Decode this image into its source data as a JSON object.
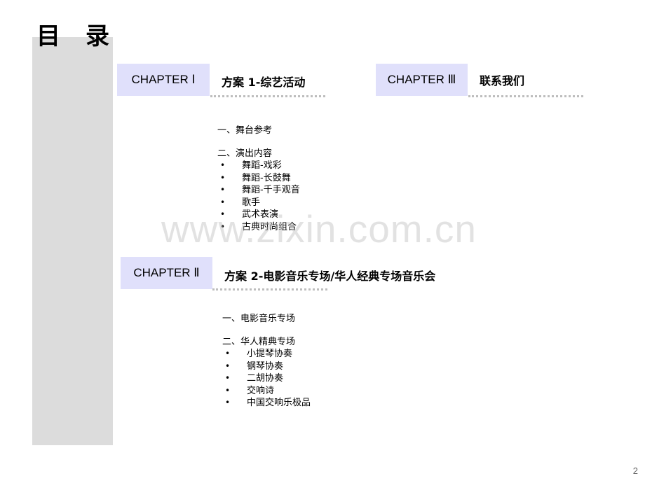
{
  "page": {
    "title_chars": [
      "目",
      "录"
    ],
    "page_number": "2",
    "watermark": "www.zixin.com.cn"
  },
  "colors": {
    "sidebar": "#dcdcdc",
    "chapter_box": "#e0e0fb",
    "dotted_line": "#bdbdbd"
  },
  "chapters": [
    {
      "label": "CHAPTER Ⅰ",
      "title": "方案 1-综艺活动",
      "items": {
        "sections": [
          {
            "heading": "一、舞台参考",
            "bullets": []
          },
          {
            "heading": "二、演出内容",
            "bullets": [
              "舞蹈-戏彩",
              "舞蹈-长鼓舞",
              "舞蹈-千手观音",
              "歌手",
              "武术表演",
              "古典时尚组合"
            ]
          }
        ]
      }
    },
    {
      "label": "CHAPTER Ⅱ",
      "title": "方案 2-电影音乐专场/华人经典专场音乐会",
      "items": {
        "sections": [
          {
            "heading": "一、电影音乐专场",
            "bullets": []
          },
          {
            "heading": "二、华人精典专场",
            "bullets": [
              "小提琴协奏",
              "钢琴协奏",
              "二胡协奏",
              "交响诗",
              "中国交响乐极品"
            ]
          }
        ]
      }
    },
    {
      "label": "CHAPTER Ⅲ",
      "title": "联系我们",
      "items": {
        "sections": []
      }
    }
  ],
  "bullet_glyph": "•"
}
